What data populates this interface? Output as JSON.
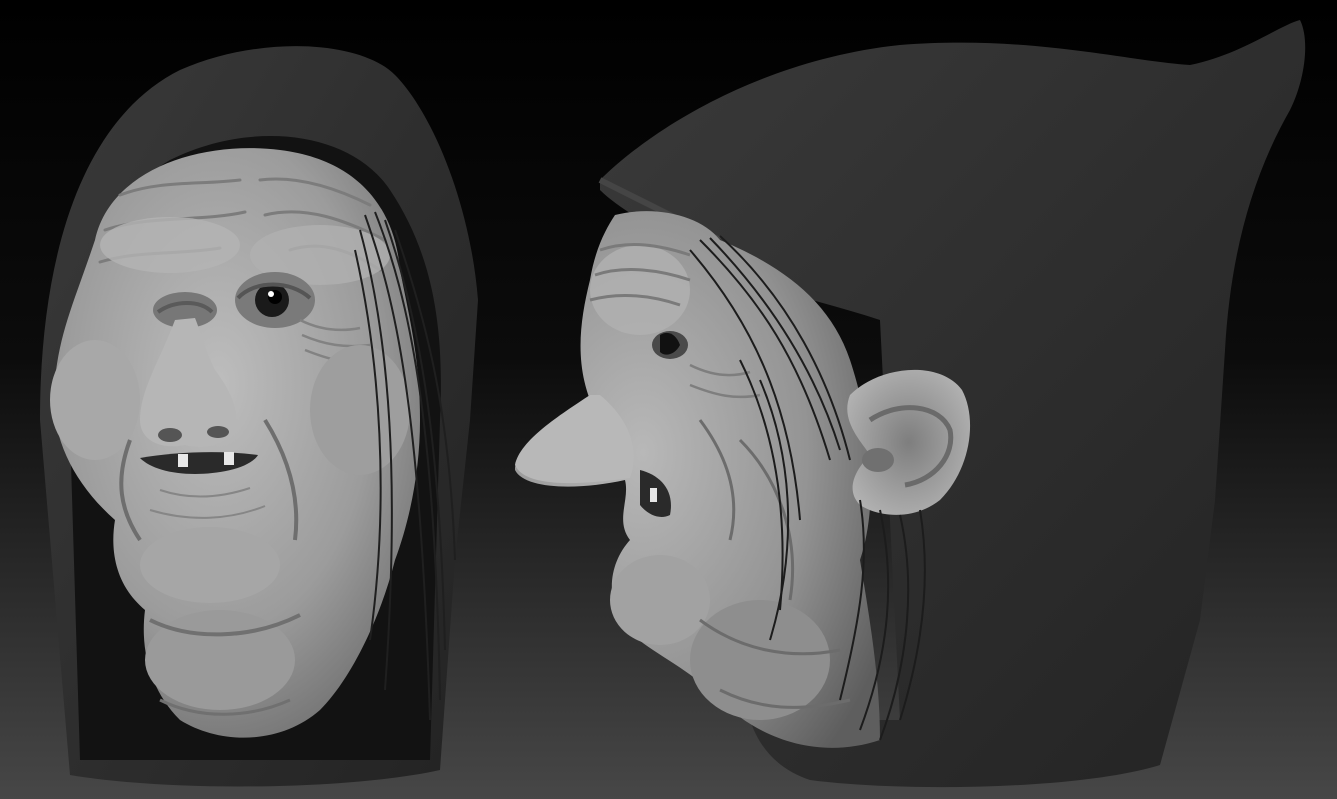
{
  "scene": {
    "background_top": "#000000",
    "background_bottom": "#464646",
    "hood_color": "#2e2e2e",
    "skin_color": "#a2a2a2",
    "hair_color": "#222222",
    "views": [
      {
        "name": "front-view"
      },
      {
        "name": "side-view"
      }
    ]
  }
}
